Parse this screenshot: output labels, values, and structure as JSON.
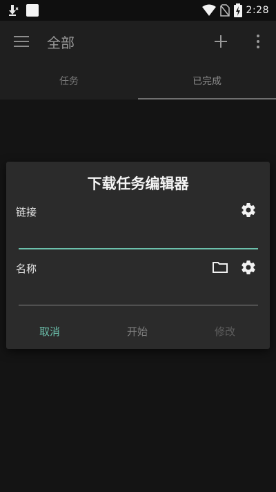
{
  "status_bar": {
    "time": "2:28",
    "icons": [
      "download-notification-icon",
      "notification-box-icon",
      "wifi-icon",
      "no-sim-icon",
      "battery-charging-icon"
    ]
  },
  "app_bar": {
    "title": "全部",
    "icons": [
      "menu-icon",
      "add-icon",
      "more-icon"
    ]
  },
  "tabs": [
    {
      "label": "任务",
      "active": false
    },
    {
      "label": "已完成",
      "active": true
    }
  ],
  "dialog": {
    "title": "下载任务编辑器",
    "url_field": {
      "label": "链接",
      "value": "",
      "placeholder": ""
    },
    "name_field": {
      "label": "名称",
      "value": "",
      "placeholder": ""
    },
    "buttons": {
      "cancel": "取消",
      "start": "开始",
      "modify": "修改"
    }
  },
  "colors": {
    "accent": "#6cc0ac",
    "background": "#141414",
    "appbar": "#1f1f1f",
    "dialog": "#2b2b2b"
  }
}
